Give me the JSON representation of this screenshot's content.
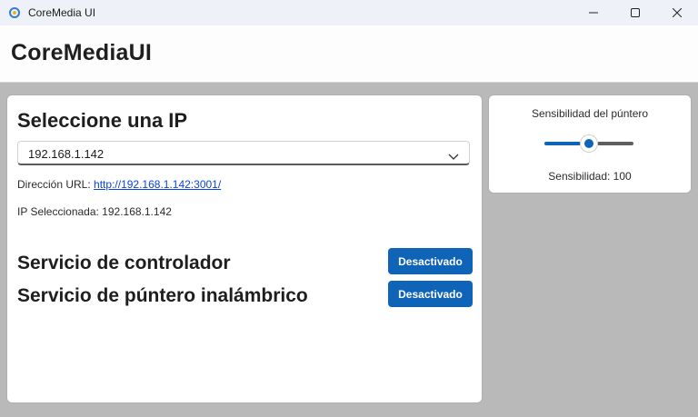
{
  "window": {
    "title": "CoreMedia UI"
  },
  "header": {
    "title": "CoreMediaUI"
  },
  "ip_section": {
    "title": "Seleccione una IP",
    "selected_ip": "192.168.1.142",
    "url_label": "Dirección URL:",
    "url_value": "http://192.168.1.142:3001/",
    "selected_label": "IP Seleccionada: 192.168.1.142"
  },
  "services": [
    {
      "label": "Servicio de controlador",
      "button_label": "Desactivado"
    },
    {
      "label": "Servicio de púntero inalámbrico",
      "button_label": "Desactivado"
    }
  ],
  "sensitivity": {
    "title": "Sensibilidad del púntero",
    "value": 100,
    "level_fraction": 0.5,
    "value_text": "Sensibilidad: 100"
  },
  "colors": {
    "accent": "#0f64b8",
    "link": "#0b45d8",
    "background": "#b9b9b9"
  }
}
